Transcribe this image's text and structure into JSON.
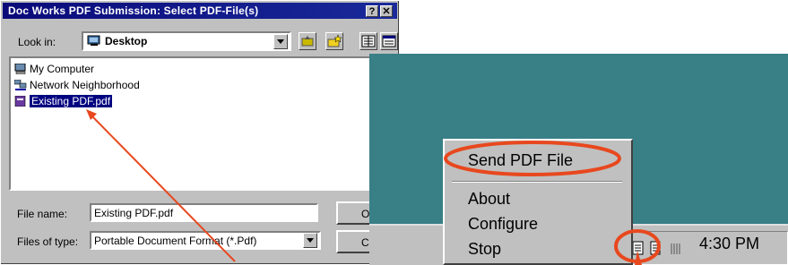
{
  "dialog": {
    "title": "Doc Works PDF Submission: Select PDF-File(s)",
    "help_btn": "?",
    "close_btn": "✕",
    "look_in_label": "Look in:",
    "look_in_value": "Desktop",
    "files": [
      "My Computer",
      "Network Neighborhood",
      "Existing PDF.pdf"
    ],
    "file_name_label": "File name:",
    "file_name_value": "Existing PDF.pdf",
    "files_of_type_label": "Files of type:",
    "files_of_type_value": "Portable Document Format (*.Pdf)",
    "open_button": "Op",
    "cancel_button": "Ca"
  },
  "tray_menu": {
    "items": [
      "Send PDF File",
      "About",
      "Configure",
      "Stop"
    ]
  },
  "taskbar": {
    "clock": "4:30 PM"
  },
  "colors": {
    "desktop": "#387f86",
    "title_bar": "#0a0a7a",
    "highlight": "#000080",
    "annotation": "#e8481e"
  }
}
